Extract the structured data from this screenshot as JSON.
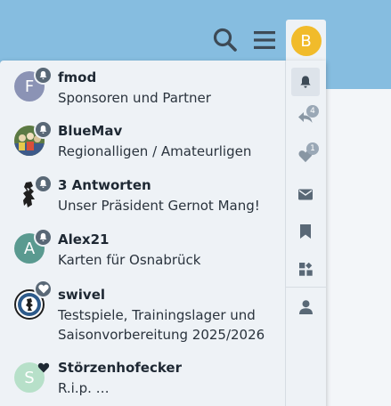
{
  "header": {
    "search_icon": "search-icon",
    "menu_icon": "hamburger-icon",
    "user_avatar_letter": "B",
    "colors": {
      "header_bg": "#86bde0",
      "avatar_bg": "#f1bb2b",
      "icon": "#3d4a56"
    }
  },
  "notifications": [
    {
      "username": "fmod",
      "message": "Sponsoren und Partner",
      "avatar_letter": "F",
      "avatar_color": "#8b93b5",
      "badge_icon": "bell-icon"
    },
    {
      "username": "BlueMav",
      "message": "Regionalligen / Amateurligen",
      "avatar_letter": "",
      "avatar_color": "#4b6f3a",
      "badge_icon": "bell-icon"
    },
    {
      "username": "3 Antworten",
      "message": "Unser Präsident Gernot Mang!",
      "avatar_letter": "",
      "avatar_color": "#ffffff",
      "badge_icon": "bell-icon"
    },
    {
      "username": "Alex21",
      "message": "Karten für Osnabrück",
      "avatar_letter": "A",
      "avatar_color": "#5a9a90",
      "badge_icon": "bell-icon"
    },
    {
      "username": "swivel",
      "message": "Testspiele, Trainingslager und Saisonvorbereitung 2025/2026",
      "avatar_letter": "",
      "avatar_color": "#2d5a8a",
      "badge_icon": "heart-icon"
    },
    {
      "username": "Störzenhofecker",
      "message": "R.i.p. …",
      "avatar_letter": "S",
      "avatar_color": "#b7e0c9",
      "badge_icon": "heart-icon"
    }
  ],
  "sidebar": {
    "items": [
      {
        "name": "notifications",
        "icon": "bell-icon",
        "active": true
      },
      {
        "name": "replies",
        "icon": "reply-icon",
        "count": "4"
      },
      {
        "name": "likes",
        "icon": "heart-icon",
        "count": "1"
      },
      {
        "name": "messages",
        "icon": "envelope-icon"
      },
      {
        "name": "bookmarks",
        "icon": "bookmark-icon"
      },
      {
        "name": "other",
        "icon": "widgets-icon"
      },
      {
        "name": "profile",
        "icon": "user-icon"
      }
    ]
  }
}
